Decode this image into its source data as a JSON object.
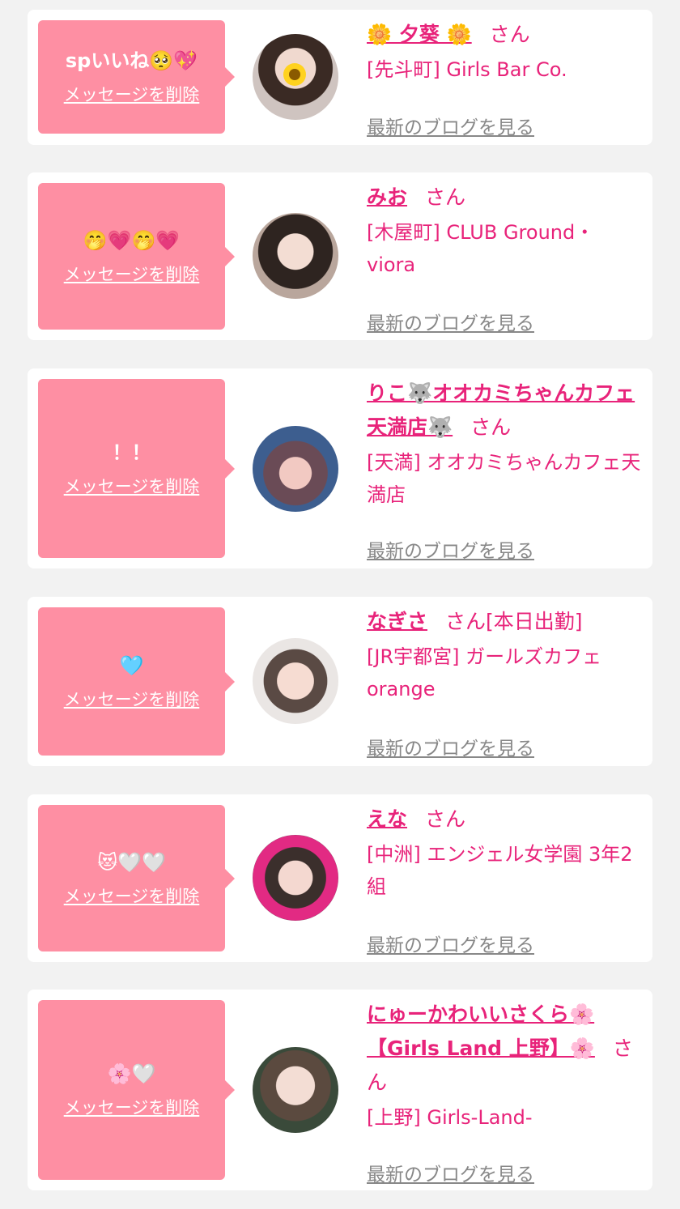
{
  "cards": [
    {
      "message": "spいいね🥺💖",
      "delete_label": "メッセージを削除",
      "name": "🌼 夕葵 🌼",
      "san": "さん",
      "shop": "[先斗町] Girls Bar Co.",
      "blog_label": "最新のブログを見る"
    },
    {
      "message": "🤭💗🤭💗",
      "delete_label": "メッセージを削除",
      "name": "みお",
      "san": "さん",
      "shop": "[木屋町] CLUB Ground・viora",
      "blog_label": "最新のブログを見る"
    },
    {
      "message": "！！",
      "delete_label": "メッセージを削除",
      "name": "りこ🐺オオカミちゃんカフェ天満店🐺",
      "san": "さん",
      "shop": "[天満] オオカミちゃんカフェ天満店",
      "blog_label": "最新のブログを見る"
    },
    {
      "message": "🩵",
      "delete_label": "メッセージを削除",
      "name": "なぎさ",
      "san": "さん[本日出勤]",
      "shop": "[JR宇都宮] ガールズカフェorange",
      "blog_label": "最新のブログを見る"
    },
    {
      "message": "😻🤍🤍",
      "delete_label": "メッセージを削除",
      "name": "えな",
      "san": "さん",
      "shop": "[中洲] エンジェル女学園 3年2組",
      "blog_label": "最新のブログを見る"
    },
    {
      "message": "🌸🤍",
      "delete_label": "メッセージを削除",
      "name": "にゅーかわいいさくら🌸【Girls Land 上野】🌸",
      "san": "さん",
      "shop": "[上野] Girls-Land-",
      "blog_label": "最新のブログを見る"
    }
  ],
  "colors": {
    "bubble": "#fe8fa3",
    "accent": "#e8237a",
    "link_gray": "#888888"
  }
}
